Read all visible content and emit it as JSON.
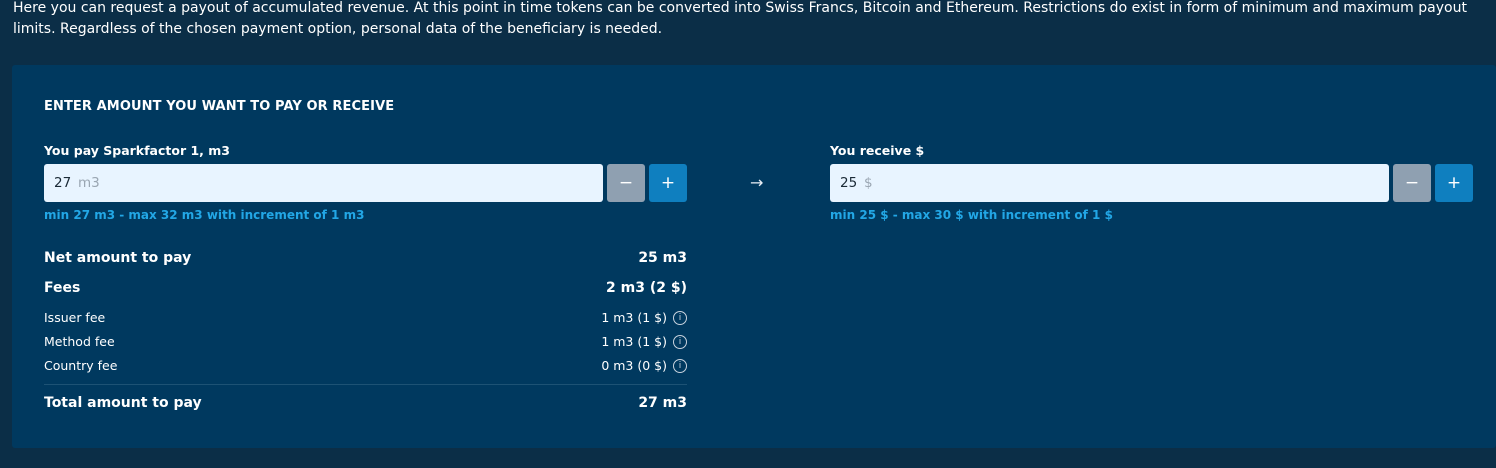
{
  "intro_text": "Here you can request a payout of accumulated revenue. At this point in time tokens can be converted into Swiss Francs, Bitcoin and Ethereum. Restrictions do exist in form of minimum and maximum payout limits. Regardless of the chosen payment option, personal data of the beneficiary is needed.",
  "card": {
    "title": "ENTER AMOUNT YOU WANT TO PAY OR RECEIVE",
    "pay": {
      "label": "You pay Sparkfactor 1, m3",
      "value": "27",
      "unit": "m3",
      "minus": "−",
      "plus": "+",
      "hint": "min 27 m3 - max 32 m3 with increment of 1 m3"
    },
    "arrow": "→",
    "receive": {
      "label": "You receive $",
      "value": "25",
      "unit": "$",
      "minus": "−",
      "plus": "+",
      "hint": "min 25 $ - max 30 $ with increment of 1 $"
    },
    "summary": {
      "net_label": "Net amount to pay",
      "net_value": "25 m3",
      "fees_label": "Fees",
      "fees_value": "2 m3 (2 $)",
      "issuer_label": "Issuer fee",
      "issuer_value": "1 m3 (1 $)",
      "method_label": "Method fee",
      "method_value": "1 m3 (1 $)",
      "country_label": "Country fee",
      "country_value": "0 m3 (0 $)",
      "total_label": "Total amount to pay",
      "total_value": "27 m3",
      "info_glyph": "i"
    }
  },
  "colors": {
    "background": "#0b2e47",
    "card": "#00395f",
    "input": "#e8f4ff",
    "minus_button": "#8fa0b1",
    "plus_button": "#0f7fbf",
    "hint": "#22a7e6"
  }
}
